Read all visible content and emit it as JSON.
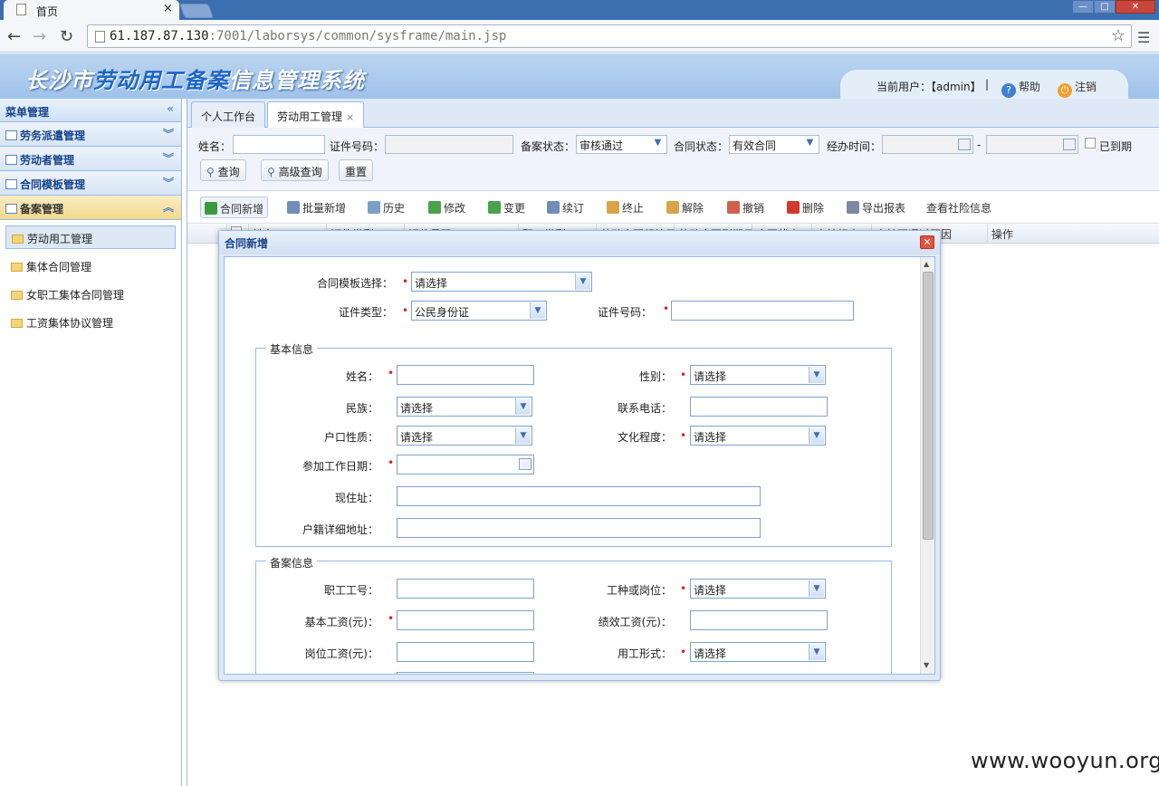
{
  "browser": {
    "tab_title": "首页",
    "tab_close": "×",
    "url_host": "61.187.87.130",
    "url_rest": ":7001/laborsys/common/sysframe/main.jsp",
    "back_icon": "arrow-left",
    "forward_icon": "arrow-right",
    "reload_icon": "reload",
    "win_min": "—",
    "win_max": "□",
    "win_close": "✕"
  },
  "header": {
    "title_prefix": "长沙市",
    "title_highlight": "劳动用工备案",
    "title_suffix": "信息管理系统",
    "current_user": "当前用户：【admin】",
    "separator": "|",
    "help": "帮助",
    "logout": "注销"
  },
  "sidebar": {
    "title": "菜单管理",
    "collapse": "«",
    "sections": [
      {
        "label": "劳务派遣管理",
        "chevron": "︾"
      },
      {
        "label": "劳动者管理",
        "chevron": "︾"
      },
      {
        "label": "合同模板管理",
        "chevron": "︾"
      },
      {
        "label": "备案管理",
        "chevron": "︽"
      }
    ],
    "items": [
      {
        "label": "劳动用工管理"
      },
      {
        "label": "集体合同管理"
      },
      {
        "label": "女职工集体合同管理"
      },
      {
        "label": "工资集体协议管理"
      }
    ]
  },
  "tabs": [
    {
      "label": "个人工作台"
    },
    {
      "label": "劳动用工管理",
      "close": "×"
    }
  ],
  "search": {
    "name_label": "姓名：",
    "id_label": "证件号码：",
    "status_label": "备案状态：",
    "status_value": "审核通过",
    "contract_status_label": "合同状态：",
    "contract_status_value": "有效合同",
    "period_label": "经办时间：",
    "dash": "-",
    "expired_label": "已到期",
    "query_btn": "查询",
    "adv_query_btn": "高级查询",
    "reset_btn": "重置"
  },
  "toolbar": [
    {
      "label": "合同新增",
      "color": "#3b9a3b"
    },
    {
      "label": "批量新增",
      "color": "#6f8fb8"
    },
    {
      "label": "历史",
      "color": "#7aa0c8"
    },
    {
      "label": "修改",
      "color": "#4aa24a"
    },
    {
      "label": "变更",
      "color": "#4aa24a"
    },
    {
      "label": "续订",
      "color": "#6f8fb8"
    },
    {
      "label": "终止",
      "color": "#d9a34a"
    },
    {
      "label": "解除",
      "color": "#d9a34a"
    },
    {
      "label": "撤销",
      "color": "#d0604a"
    },
    {
      "label": "删除",
      "color": "#d03a2a"
    },
    {
      "label": "导出报表",
      "color": "#7a8aa0"
    },
    {
      "label": "查看社险信息",
      "color": ""
    }
  ],
  "grid": {
    "columns": [
      "姓名",
      "证件类型",
      "证件号码",
      "职工类型",
      "劳动合同起始日",
      "劳动合同到期日",
      "合同状态",
      "审核标志",
      "审核不通过原因",
      "操作"
    ]
  },
  "dialog": {
    "title": "合同新增",
    "close": "✕",
    "template_label": "合同模板选择：",
    "template_value": "请选择",
    "idtype_label": "证件类型：",
    "idtype_value": "公民身份证",
    "idno_label": "证件号码：",
    "required_mark": "•",
    "basic": {
      "legend": "基本信息",
      "name": "姓名：",
      "gender": "性别：",
      "gender_value": "请选择",
      "nation": "民族：",
      "nation_value": "请选择",
      "phone": "联系电话：",
      "hukou": "户口性质：",
      "hukou_value": "请选择",
      "edu": "文化程度：",
      "edu_value": "请选择",
      "workdate": "参加工作日期：",
      "address": "现住址：",
      "hukou_addr": "户籍详细地址："
    },
    "record": {
      "legend": "备案信息",
      "staff_no": "职工工号：",
      "job": "工种或岗位：",
      "job_value": "请选择",
      "base_salary": "基本工资(元)：",
      "perf_salary": "绩效工资(元)：",
      "post_salary": "岗位工资(元)：",
      "employ_form": "用工形式：",
      "employ_form_value": "请选择"
    }
  },
  "watermark": "www.wooyun.org"
}
